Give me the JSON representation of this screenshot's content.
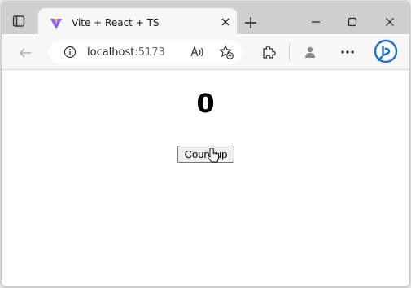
{
  "browser": {
    "tab": {
      "title": "Vite + React + TS"
    },
    "address": {
      "host": "localhost",
      "port": ":5173"
    },
    "icons": {
      "tab_actions": "tab-actions-icon",
      "favicon": "vite-logo-icon",
      "tab_close": "close-icon",
      "new_tab": "plus-icon",
      "minimize": "minimize-icon",
      "maximize": "maximize-icon",
      "close_window": "close-window-icon",
      "back": "back-arrow-icon",
      "site_info": "info-icon",
      "read_aloud": "read-aloud-icon",
      "favorites": "add-favorite-icon",
      "extensions": "puzzle-icon",
      "profile": "profile-icon",
      "menu": "more-icon",
      "copilot": "bing-icon"
    },
    "colors": {
      "bing_blue": "#1b6fd3",
      "vite_purple": "#8a5cf6",
      "vite_yellow": "#f7c32e"
    }
  },
  "app": {
    "count": "0",
    "button_label": "Count up"
  }
}
